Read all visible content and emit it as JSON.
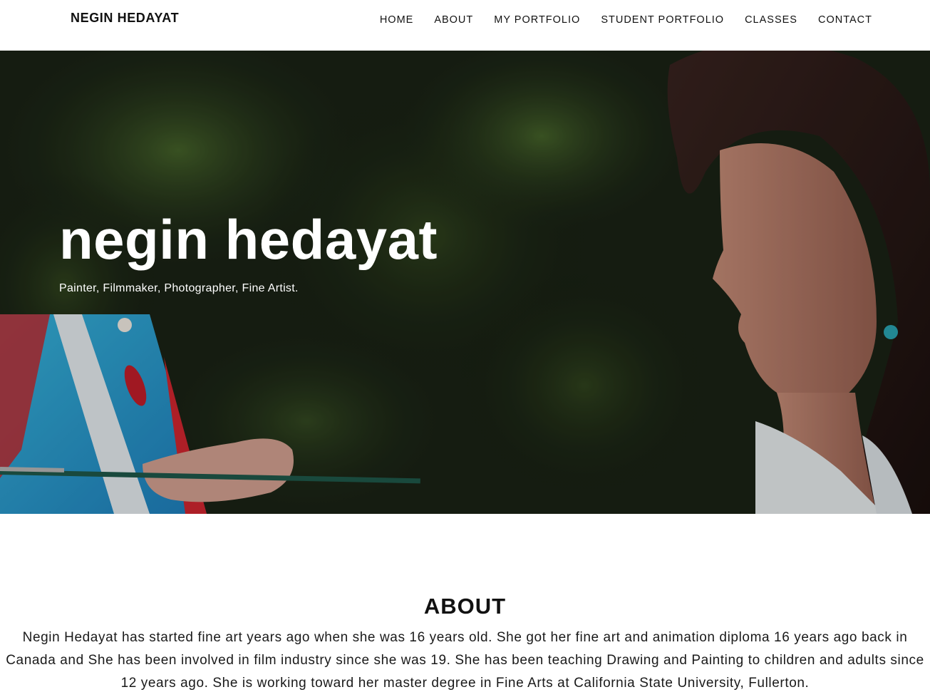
{
  "nav": {
    "brand": "NEGIN HEDAYAT",
    "items": [
      {
        "label": "HOME"
      },
      {
        "label": "ABOUT"
      },
      {
        "label": "MY PORTFOLIO"
      },
      {
        "label": "STUDENT PORTFOLIO"
      },
      {
        "label": "CLASSES"
      },
      {
        "label": "CONTACT"
      }
    ]
  },
  "hero": {
    "title": "negin hedayat",
    "subtitle": "Painter, Filmmaker, Photographer, Fine Artist."
  },
  "about": {
    "heading": "ABOUT",
    "text": "Negin Hedayat has started fine art years ago when she was 16 years old. She got her fine art and animation diploma 16 years ago back in Canada and She has been involved in film industry since she was 19. She has been teaching Drawing and Painting to children and adults since 12 years ago. She is working toward her master degree in Fine Arts at California State University, Fullerton."
  },
  "colors": {
    "nav_bg": "#ffffff",
    "hero_bg": "#1b2516",
    "text_dark": "#111111"
  }
}
